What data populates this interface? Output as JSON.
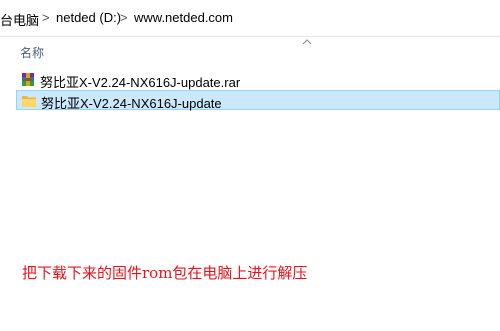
{
  "address_bar": {
    "crumbs": [
      "台电脑",
      "netded (D:)",
      "www.netded.com"
    ],
    "separator": ">"
  },
  "file_list": {
    "column_header": "名称",
    "items": [
      {
        "name": "努比亚X-V2.24-NX616J-update.rar",
        "type": "rar-archive",
        "selected": false
      },
      {
        "name": "努比亚X-V2.24-NX616J-update",
        "type": "folder",
        "selected": true
      }
    ]
  },
  "annotation": {
    "text": "把下载下来的固件rom包在电脑上进行解压",
    "color": "#e8141b"
  },
  "icons": {
    "sort": "chevron-up-icon",
    "archive": "winrar-archive-icon",
    "folder": "folder-icon"
  }
}
